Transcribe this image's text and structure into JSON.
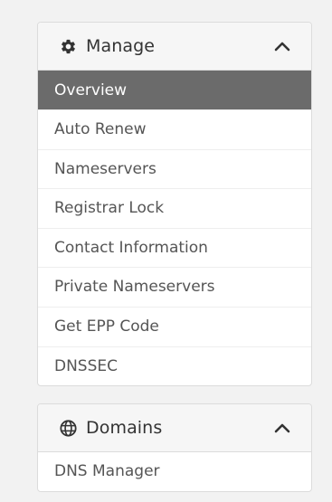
{
  "manage": {
    "title": "Manage",
    "header_icon": "gear-icon",
    "toggle_icon": "chevron-up-icon",
    "items": [
      {
        "label": "Overview",
        "active": true
      },
      {
        "label": "Auto Renew",
        "active": false
      },
      {
        "label": "Nameservers",
        "active": false
      },
      {
        "label": "Registrar Lock",
        "active": false
      },
      {
        "label": "Contact Information",
        "active": false
      },
      {
        "label": "Private Nameservers",
        "active": false
      },
      {
        "label": "Get EPP Code",
        "active": false
      },
      {
        "label": "DNSSEC",
        "active": false
      }
    ]
  },
  "domains": {
    "title": "Domains",
    "header_icon": "globe-icon",
    "toggle_icon": "chevron-up-icon",
    "items": [
      {
        "label": "DNS Manager",
        "active": false
      }
    ]
  },
  "colors": {
    "active_bg": "#6b6b6b",
    "page_bg": "#f2f2f2",
    "text": "#555555"
  }
}
